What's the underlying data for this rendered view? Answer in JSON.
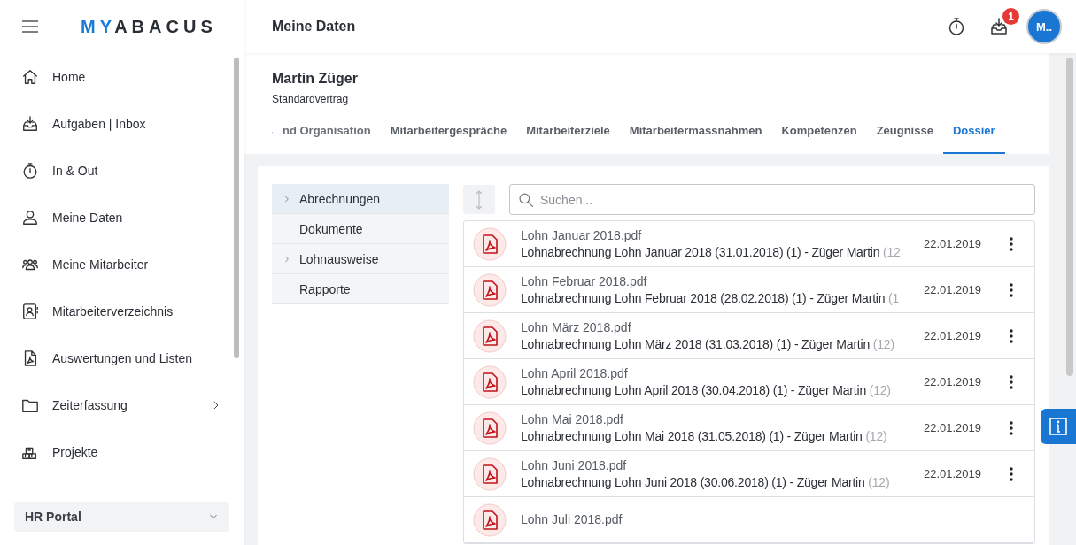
{
  "logo": {
    "part_1": "MY",
    "part_2": "ABACUS"
  },
  "sidebar": {
    "items": [
      {
        "label": "Home",
        "kind": "home",
        "expandable": false
      },
      {
        "label": "Aufgaben | Inbox",
        "kind": "inbox",
        "expandable": false
      },
      {
        "label": "In & Out",
        "kind": "timer",
        "expandable": false
      },
      {
        "label": "Meine Daten",
        "kind": "person",
        "expandable": false
      },
      {
        "label": "Meine Mitarbeiter",
        "kind": "people",
        "expandable": false
      },
      {
        "label": "Mitarbeiterverzeichnis",
        "kind": "contacts",
        "expandable": false
      },
      {
        "label": "Auswertungen und Listen",
        "kind": "pdf",
        "expandable": false
      },
      {
        "label": "Zeiterfassung",
        "kind": "folder",
        "expandable": true
      },
      {
        "label": "Projekte",
        "kind": "boxes",
        "expandable": false
      }
    ],
    "portal": "HR Portal"
  },
  "topbar": {
    "title": "Meine Daten",
    "inbox_badge": "1",
    "avatar": "M.."
  },
  "person": {
    "name": "Martin Züger",
    "contract": "Standardvertrag"
  },
  "tabs": [
    {
      "label": "nd Organisation",
      "selected": false
    },
    {
      "label": "Mitarbeitergespräche",
      "selected": false
    },
    {
      "label": "Mitarbeiterziele",
      "selected": false
    },
    {
      "label": "Mitarbeitermassnahmen",
      "selected": false
    },
    {
      "label": "Kompetenzen",
      "selected": false
    },
    {
      "label": "Zeugnisse",
      "selected": false
    },
    {
      "label": "Dossier",
      "selected": true
    }
  ],
  "tree": [
    {
      "label": "Abrechnungen",
      "expandable": true,
      "selected": true
    },
    {
      "label": "Dokumente",
      "expandable": false,
      "selected": false
    },
    {
      "label": "Lohnausweise",
      "expandable": true,
      "selected": false
    },
    {
      "label": "Rapporte",
      "expandable": false,
      "selected": false
    }
  ],
  "search": {
    "placeholder": "Suchen..."
  },
  "documents": [
    {
      "name": "Lohn Januar 2018.pdf",
      "description": "Lohnabrechnung Lohn Januar 2018 (31.01.2018) (1) - Züger Martin",
      "count": "(12",
      "date": "22.01.2019"
    },
    {
      "name": "Lohn Februar 2018.pdf",
      "description": "Lohnabrechnung Lohn Februar 2018 (28.02.2018) (1) - Züger Martin",
      "count": "(1",
      "date": "22.01.2019"
    },
    {
      "name": "Lohn März 2018.pdf",
      "description": "Lohnabrechnung Lohn März 2018 (31.03.2018) (1) - Züger Martin",
      "count": "(12)",
      "date": "22.01.2019"
    },
    {
      "name": "Lohn April 2018.pdf",
      "description": "Lohnabrechnung Lohn April 2018 (30.04.2018) (1) - Züger Martin",
      "count": "(12)",
      "date": "22.01.2019"
    },
    {
      "name": "Lohn Mai 2018.pdf",
      "description": "Lohnabrechnung Lohn Mai 2018 (31.05.2018) (1) - Züger Martin",
      "count": "(12)",
      "date": "22.01.2019"
    },
    {
      "name": "Lohn Juni 2018.pdf",
      "description": "Lohnabrechnung Lohn Juni 2018 (30.06.2018) (1) - Züger Martin",
      "count": "(12)",
      "date": "22.01.2019"
    },
    {
      "name": "Lohn Juli 2018.pdf"
    }
  ]
}
